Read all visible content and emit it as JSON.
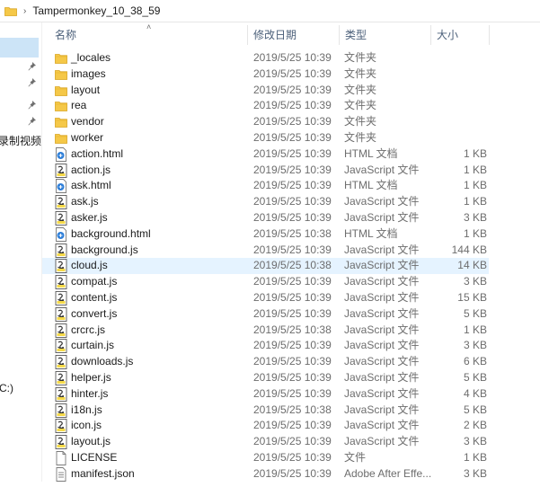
{
  "address": {
    "crumb": "Tampermonkey_10_38_59"
  },
  "nav": {
    "item_record": "录制视频",
    "item_drive": "C:)"
  },
  "columns": {
    "name": "名称",
    "date": "修改日期",
    "type": "类型",
    "size": "大小"
  },
  "files": [
    {
      "name": "_locales",
      "date": "2019/5/25 10:39",
      "type": "文件夹",
      "size": "",
      "icon": "folder-icon"
    },
    {
      "name": "images",
      "date": "2019/5/25 10:39",
      "type": "文件夹",
      "size": "",
      "icon": "folder-icon"
    },
    {
      "name": "layout",
      "date": "2019/5/25 10:39",
      "type": "文件夹",
      "size": "",
      "icon": "folder-icon"
    },
    {
      "name": "rea",
      "date": "2019/5/25 10:39",
      "type": "文件夹",
      "size": "",
      "icon": "folder-icon"
    },
    {
      "name": "vendor",
      "date": "2019/5/25 10:39",
      "type": "文件夹",
      "size": "",
      "icon": "folder-icon"
    },
    {
      "name": "worker",
      "date": "2019/5/25 10:39",
      "type": "文件夹",
      "size": "",
      "icon": "folder-icon"
    },
    {
      "name": "action.html",
      "date": "2019/5/25 10:39",
      "type": "HTML 文档",
      "size": "1 KB",
      "icon": "html-file-icon"
    },
    {
      "name": "action.js",
      "date": "2019/5/25 10:39",
      "type": "JavaScript 文件",
      "size": "1 KB",
      "icon": "js-file-icon"
    },
    {
      "name": "ask.html",
      "date": "2019/5/25 10:39",
      "type": "HTML 文档",
      "size": "1 KB",
      "icon": "html-file-icon"
    },
    {
      "name": "ask.js",
      "date": "2019/5/25 10:39",
      "type": "JavaScript 文件",
      "size": "1 KB",
      "icon": "js-file-icon"
    },
    {
      "name": "asker.js",
      "date": "2019/5/25 10:39",
      "type": "JavaScript 文件",
      "size": "3 KB",
      "icon": "js-file-icon"
    },
    {
      "name": "background.html",
      "date": "2019/5/25 10:38",
      "type": "HTML 文档",
      "size": "1 KB",
      "icon": "html-file-icon"
    },
    {
      "name": "background.js",
      "date": "2019/5/25 10:39",
      "type": "JavaScript 文件",
      "size": "144 KB",
      "icon": "js-file-icon"
    },
    {
      "name": "cloud.js",
      "date": "2019/5/25 10:38",
      "type": "JavaScript 文件",
      "size": "14 KB",
      "icon": "js-file-icon",
      "selected": true
    },
    {
      "name": "compat.js",
      "date": "2019/5/25 10:39",
      "type": "JavaScript 文件",
      "size": "3 KB",
      "icon": "js-file-icon"
    },
    {
      "name": "content.js",
      "date": "2019/5/25 10:39",
      "type": "JavaScript 文件",
      "size": "15 KB",
      "icon": "js-file-icon"
    },
    {
      "name": "convert.js",
      "date": "2019/5/25 10:39",
      "type": "JavaScript 文件",
      "size": "5 KB",
      "icon": "js-file-icon"
    },
    {
      "name": "crcrc.js",
      "date": "2019/5/25 10:38",
      "type": "JavaScript 文件",
      "size": "1 KB",
      "icon": "js-file-icon"
    },
    {
      "name": "curtain.js",
      "date": "2019/5/25 10:39",
      "type": "JavaScript 文件",
      "size": "3 KB",
      "icon": "js-file-icon"
    },
    {
      "name": "downloads.js",
      "date": "2019/5/25 10:39",
      "type": "JavaScript 文件",
      "size": "6 KB",
      "icon": "js-file-icon"
    },
    {
      "name": "helper.js",
      "date": "2019/5/25 10:39",
      "type": "JavaScript 文件",
      "size": "5 KB",
      "icon": "js-file-icon"
    },
    {
      "name": "hinter.js",
      "date": "2019/5/25 10:39",
      "type": "JavaScript 文件",
      "size": "4 KB",
      "icon": "js-file-icon"
    },
    {
      "name": "i18n.js",
      "date": "2019/5/25 10:38",
      "type": "JavaScript 文件",
      "size": "5 KB",
      "icon": "js-file-icon"
    },
    {
      "name": "icon.js",
      "date": "2019/5/25 10:39",
      "type": "JavaScript 文件",
      "size": "2 KB",
      "icon": "js-file-icon"
    },
    {
      "name": "layout.js",
      "date": "2019/5/25 10:39",
      "type": "JavaScript 文件",
      "size": "3 KB",
      "icon": "js-file-icon"
    },
    {
      "name": "LICENSE",
      "date": "2019/5/25 10:39",
      "type": "文件",
      "size": "1 KB",
      "icon": "blank-file-icon"
    },
    {
      "name": "manifest.json",
      "date": "2019/5/25 10:39",
      "type": "Adobe After Effe...",
      "size": "3 KB",
      "icon": "json-file-icon"
    }
  ],
  "colors": {
    "selection": "#e5f3ff",
    "nav_selection": "#cce4f7",
    "folder": "#f5c848",
    "header_text": "#4c607a"
  }
}
